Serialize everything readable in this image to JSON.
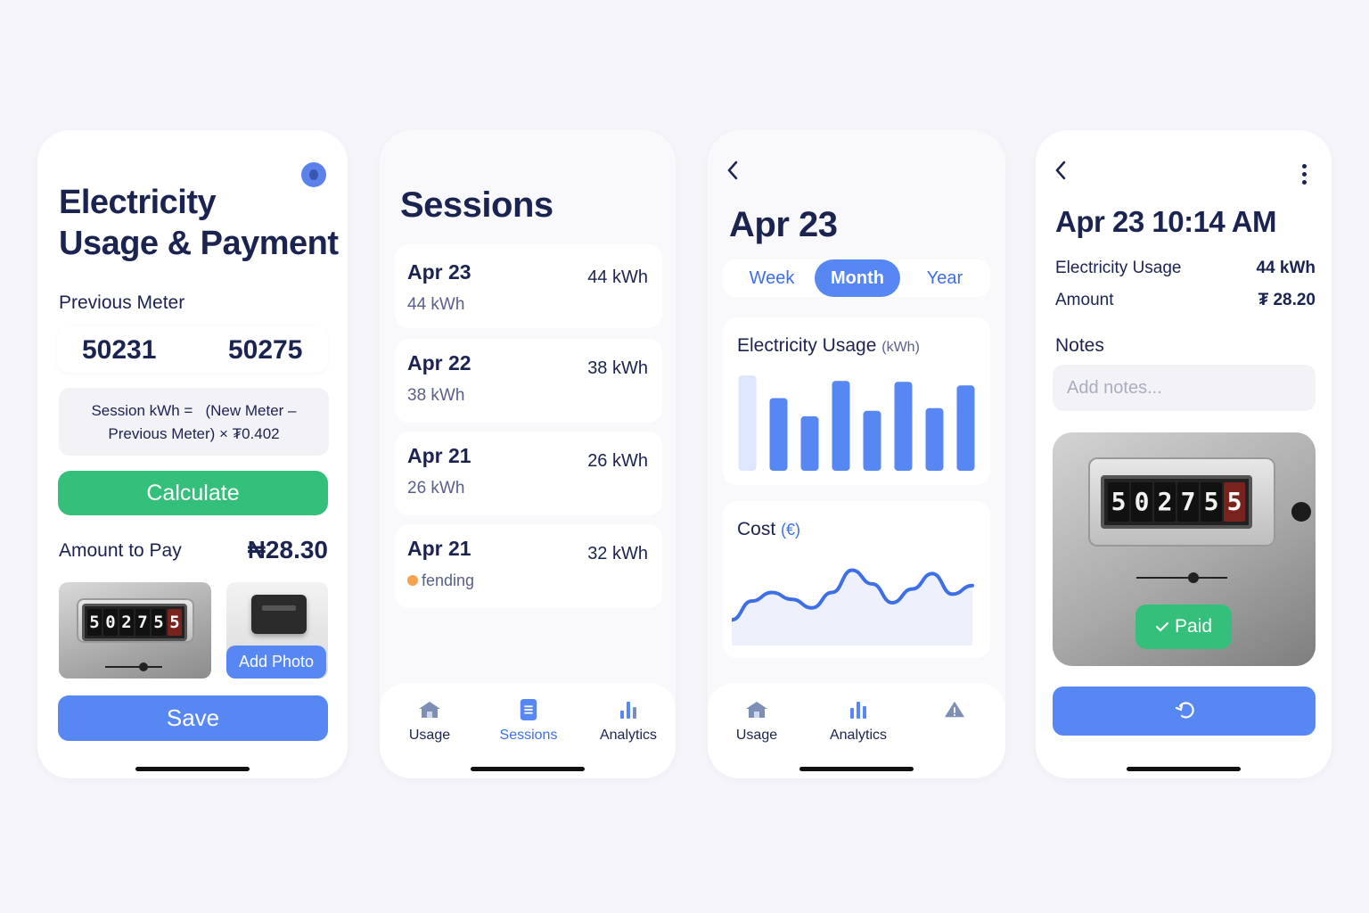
{
  "screen_usage": {
    "title_line1": "Electricity",
    "title_line2": "Usage & Payment",
    "previous_meter_label": "Previous Meter",
    "previous_meter_value": "50231",
    "new_meter_value": "50275",
    "formula_line1": "Session kWh =   (New Meter –",
    "formula_line2": "Previous Meter) × ₮0.402",
    "calculate_label": "Calculate",
    "amount_label": "Amount to Pay",
    "amount_value": "₦28.30",
    "meter_digits": [
      "5",
      "0",
      "2",
      "7",
      "5",
      "5"
    ],
    "add_photo_label": "Add Photo",
    "save_label": "Save"
  },
  "screen_sessions": {
    "title": "Sessions",
    "sessions": [
      {
        "date": "Apr 23",
        "sub": "44 kWh",
        "kwh": "44 kWh"
      },
      {
        "date": "Apr 22",
        "sub": "38 kWh",
        "kwh": "38 kWh"
      },
      {
        "date": "Apr 21",
        "sub": "26 kWh",
        "kwh": "26 kWh"
      },
      {
        "date": "Apr 21",
        "sub": "fending",
        "kwh": "32 kWh",
        "status_color": "#f5a24e"
      }
    ],
    "tabs": [
      {
        "label": "Usage",
        "icon": "home-icon"
      },
      {
        "label": "Sessions",
        "icon": "document-icon",
        "active": true
      },
      {
        "label": "Analytics",
        "icon": "bar-chart-icon"
      }
    ]
  },
  "screen_analytics": {
    "title": "Apr 23",
    "periods": [
      {
        "label": "Week"
      },
      {
        "label": "Month",
        "selected": true
      },
      {
        "label": "Year"
      }
    ],
    "usage_card_title": "Electricity Usage",
    "usage_card_unit": "(kWh)",
    "cost_card_title": "Cost",
    "cost_card_unit": "(€)",
    "tabs": [
      {
        "label": "Usage",
        "icon": "home-icon"
      },
      {
        "label": "Analytics",
        "icon": "bar-chart-icon",
        "active": true
      },
      {
        "label": "",
        "icon": "warning-icon"
      }
    ]
  },
  "chart_data": [
    {
      "type": "bar",
      "title": "Electricity Usage",
      "ylabel": "(kWh)",
      "values": [
        105,
        80,
        60,
        99,
        66,
        98,
        69,
        94
      ],
      "ylim": [
        0,
        110
      ],
      "highlight": [
        false,
        true,
        true,
        true,
        true,
        true,
        true,
        true
      ],
      "colors": {
        "bar": "#5787f2",
        "faded": "#dde6fb"
      }
    },
    {
      "type": "area",
      "title": "Cost",
      "ylabel": "(€)",
      "x": [
        0,
        1,
        2,
        3,
        4,
        5,
        6,
        7,
        8,
        9,
        10,
        11,
        12
      ],
      "values": [
        30,
        52,
        62,
        54,
        44,
        62,
        88,
        72,
        50,
        66,
        84,
        60,
        70
      ],
      "ylim": [
        0,
        100
      ],
      "colors": {
        "line": "#3d6fe6",
        "fill": "#eef1fc"
      }
    }
  ],
  "screen_detail": {
    "title": "Apr 23 10:14 AM",
    "usage_label": "Electricity Usage",
    "usage_value": "44 kWh",
    "amount_label": "Amount",
    "amount_value": "₮ 28.20",
    "notes_label": "Notes",
    "notes_placeholder": "Add notes...",
    "meter_digits": [
      "5",
      "0",
      "2",
      "7",
      "5",
      "5"
    ],
    "paid_label": "Paid"
  },
  "colors": {
    "accent": "#5787f2",
    "success": "#34bf7a",
    "text": "#1b2350",
    "pending": "#f5a24e"
  }
}
